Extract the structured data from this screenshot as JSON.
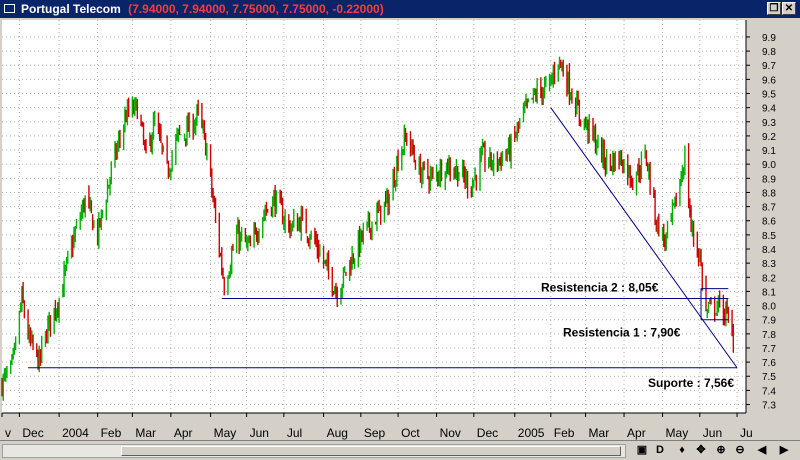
{
  "window": {
    "title": "Portugal Telecom",
    "quote": "(7.94000, 7.94000, 7.75000, 7.75000, -0.22000)",
    "buttons": [
      "restore-icon",
      "close-icon"
    ]
  },
  "toolbar": {
    "buttons": [
      {
        "name": "chart-style-icon",
        "glyph": "▣"
      },
      {
        "name": "daily-period-button",
        "glyph": "D"
      },
      {
        "name": "periodicity-icon",
        "glyph": "♦"
      },
      {
        "name": "move-icon",
        "glyph": "✥"
      },
      {
        "name": "zoom-in-icon",
        "glyph": "⊕"
      },
      {
        "name": "zoom-out-icon",
        "glyph": "⊖"
      },
      {
        "name": "scroll-left-icon",
        "glyph": "◀"
      },
      {
        "name": "scroll-right-icon",
        "glyph": "▶"
      }
    ]
  },
  "colors": {
    "background": "#ffffff",
    "up": "#00b000",
    "down": "#d00000",
    "trendline": "#00008b",
    "grid": "#b0b0b0"
  },
  "chart_data": {
    "type": "candlestick",
    "ylim": [
      7.24,
      10.02
    ],
    "yticks": [
      7.3,
      7.4,
      7.5,
      7.6,
      7.7,
      7.8,
      7.9,
      8.0,
      8.1,
      8.2,
      8.3,
      8.4,
      8.5,
      8.6,
      8.7,
      8.8,
      8.9,
      9.0,
      9.1,
      9.2,
      9.3,
      9.4,
      9.5,
      9.6,
      9.7,
      9.8,
      9.9
    ],
    "ytick_labels": [
      "7.3",
      "7.4",
      "7.5",
      "7.6",
      "7.7",
      "7.8",
      "7.9",
      "8.0",
      "8.1",
      "8.2",
      "8.3",
      "8.4",
      "8.5",
      "8.6",
      "8.7",
      "8.8",
      "8.9",
      "9.0",
      "9.1",
      "9.2",
      "9.3",
      "9.4",
      "9.5",
      "9.6",
      "9.7",
      "9.8",
      "9.9"
    ],
    "x_range": [
      "2003-11-17",
      "2005-07-05"
    ],
    "xticks": [
      {
        "label": "v",
        "date": "2003-11-17"
      },
      {
        "label": "Dec",
        "date": "2003-12-01"
      },
      {
        "label": "2004",
        "date": "2004-01-02"
      },
      {
        "label": "Feb",
        "date": "2004-02-02"
      },
      {
        "label": "Mar",
        "date": "2004-03-01"
      },
      {
        "label": "Apr",
        "date": "2004-04-01"
      },
      {
        "label": "May",
        "date": "2004-05-03"
      },
      {
        "label": "Jun",
        "date": "2004-06-01"
      },
      {
        "label": "Jul",
        "date": "2004-07-01"
      },
      {
        "label": "Aug",
        "date": "2004-08-02"
      },
      {
        "label": "Sep",
        "date": "2004-09-01"
      },
      {
        "label": "Oct",
        "date": "2004-10-01"
      },
      {
        "label": "Nov",
        "date": "2004-11-01"
      },
      {
        "label": "Dec",
        "date": "2004-12-01"
      },
      {
        "label": "2005",
        "date": "2005-01-03"
      },
      {
        "label": "Feb",
        "date": "2005-02-01"
      },
      {
        "label": "Mar",
        "date": "2005-03-01"
      },
      {
        "label": "Apr",
        "date": "2005-04-01"
      },
      {
        "label": "May",
        "date": "2005-05-02"
      },
      {
        "label": "Jun",
        "date": "2005-06-01"
      },
      {
        "label": "Ju",
        "date": "2005-07-01"
      }
    ],
    "price_path": [
      {
        "date": "2003-11-17",
        "close": 7.45
      },
      {
        "date": "2003-11-25",
        "close": 7.55
      },
      {
        "date": "2003-12-03",
        "close": 8.05
      },
      {
        "date": "2003-12-09",
        "close": 7.75
      },
      {
        "date": "2003-12-17",
        "close": 7.6
      },
      {
        "date": "2003-12-24",
        "close": 7.85
      },
      {
        "date": "2004-01-02",
        "close": 8.05
      },
      {
        "date": "2004-01-13",
        "close": 8.45
      },
      {
        "date": "2004-01-23",
        "close": 8.75
      },
      {
        "date": "2004-02-02",
        "close": 8.5
      },
      {
        "date": "2004-02-13",
        "close": 8.95
      },
      {
        "date": "2004-02-25",
        "close": 9.35
      },
      {
        "date": "2004-03-05",
        "close": 9.4
      },
      {
        "date": "2004-03-12",
        "close": 9.05
      },
      {
        "date": "2004-03-19",
        "close": 9.3
      },
      {
        "date": "2004-03-29",
        "close": 8.95
      },
      {
        "date": "2004-04-07",
        "close": 9.2
      },
      {
        "date": "2004-04-16",
        "close": 9.25
      },
      {
        "date": "2004-04-23",
        "close": 9.35
      },
      {
        "date": "2004-04-30",
        "close": 9.1
      },
      {
        "date": "2004-05-07",
        "close": 8.6
      },
      {
        "date": "2004-05-14",
        "close": 8.15
      },
      {
        "date": "2004-05-24",
        "close": 8.5
      },
      {
        "date": "2004-06-04",
        "close": 8.4
      },
      {
        "date": "2004-06-14",
        "close": 8.65
      },
      {
        "date": "2004-06-24",
        "close": 8.75
      },
      {
        "date": "2004-07-05",
        "close": 8.55
      },
      {
        "date": "2004-07-15",
        "close": 8.6
      },
      {
        "date": "2004-07-26",
        "close": 8.45
      },
      {
        "date": "2004-08-05",
        "close": 8.25
      },
      {
        "date": "2004-08-13",
        "close": 8.1
      },
      {
        "date": "2004-08-23",
        "close": 8.3
      },
      {
        "date": "2004-09-03",
        "close": 8.5
      },
      {
        "date": "2004-09-15",
        "close": 8.65
      },
      {
        "date": "2004-09-24",
        "close": 8.75
      },
      {
        "date": "2004-10-01",
        "close": 9.05
      },
      {
        "date": "2004-10-08",
        "close": 9.2
      },
      {
        "date": "2004-10-18",
        "close": 8.95
      },
      {
        "date": "2004-10-29",
        "close": 8.9
      },
      {
        "date": "2004-11-08",
        "close": 9.0
      },
      {
        "date": "2004-11-18",
        "close": 8.95
      },
      {
        "date": "2004-11-29",
        "close": 8.85
      },
      {
        "date": "2004-12-08",
        "close": 9.05
      },
      {
        "date": "2004-12-17",
        "close": 9.0
      },
      {
        "date": "2004-12-30",
        "close": 9.1
      },
      {
        "date": "2005-01-10",
        "close": 9.35
      },
      {
        "date": "2005-01-20",
        "close": 9.5
      },
      {
        "date": "2005-01-31",
        "close": 9.55
      },
      {
        "date": "2005-02-07",
        "close": 9.75
      },
      {
        "date": "2005-02-14",
        "close": 9.6
      },
      {
        "date": "2005-02-24",
        "close": 9.35
      },
      {
        "date": "2005-03-07",
        "close": 9.2
      },
      {
        "date": "2005-03-18",
        "close": 9.0
      },
      {
        "date": "2005-03-29",
        "close": 9.05
      },
      {
        "date": "2005-04-08",
        "close": 8.9
      },
      {
        "date": "2005-04-19",
        "close": 9.05
      },
      {
        "date": "2005-04-27",
        "close": 8.6
      },
      {
        "date": "2005-05-04",
        "close": 8.45
      },
      {
        "date": "2005-05-12",
        "close": 8.7
      },
      {
        "date": "2005-05-20",
        "close": 9.05
      },
      {
        "date": "2005-05-25",
        "close": 8.55
      },
      {
        "date": "2005-06-01",
        "close": 8.35
      },
      {
        "date": "2005-06-06",
        "close": 7.95
      },
      {
        "date": "2005-06-14",
        "close": 8.0
      },
      {
        "date": "2005-06-22",
        "close": 7.95
      },
      {
        "date": "2005-06-28",
        "close": 7.75
      }
    ],
    "annotations": [
      {
        "text": "Resistencia 2 : 8,05€",
        "level": 8.05
      },
      {
        "text": "Resistencia 1 : 7,90€",
        "level": 7.9
      },
      {
        "text": "Suporte : 7,56€",
        "level": 7.56
      }
    ],
    "trendlines": [
      {
        "name": "resistencia-2-line",
        "from": {
          "date": "2004-05-12",
          "value": 8.05
        },
        "to": {
          "date": "2005-06-24",
          "value": 8.05
        }
      },
      {
        "name": "resistencia-2-box-top",
        "from": {
          "date": "2005-06-02",
          "value": 8.12
        },
        "to": {
          "date": "2005-06-24",
          "value": 8.12
        }
      },
      {
        "name": "resistencia-1-line",
        "from": {
          "date": "2005-06-02",
          "value": 7.9
        },
        "to": {
          "date": "2005-06-24",
          "value": 7.9
        }
      },
      {
        "name": "suporte-line",
        "from": {
          "date": "2003-12-08",
          "value": 7.56
        },
        "to": {
          "date": "2005-07-01",
          "value": 7.56
        }
      },
      {
        "name": "downtrend-line",
        "from": {
          "date": "2005-02-01",
          "value": 9.4
        },
        "to": {
          "date": "2005-07-01",
          "value": 7.56
        }
      }
    ],
    "grid": true
  }
}
